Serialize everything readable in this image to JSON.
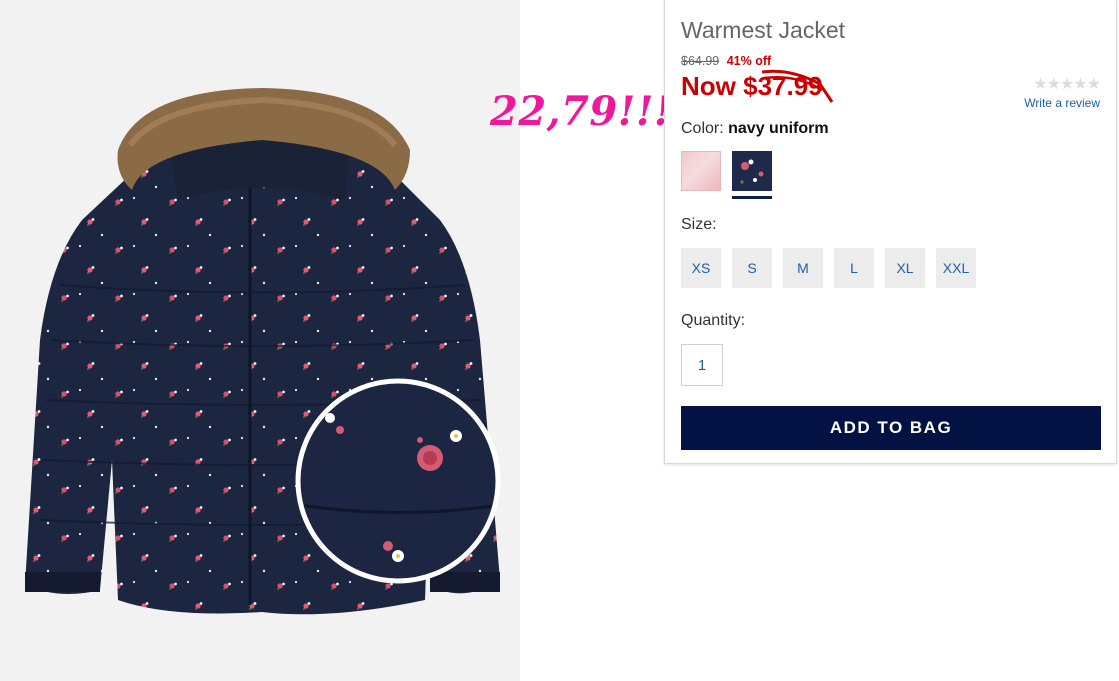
{
  "product": {
    "title": "Warmest Jacket",
    "original_price": "$64.99",
    "discount": "41% off",
    "now_label": "Now ",
    "now_price": "$37.99",
    "annotation": "22,79!!!"
  },
  "rating": {
    "stars": "★★★★★",
    "review_link": "Write a review"
  },
  "color": {
    "label": "Color: ",
    "selected": "navy uniform",
    "swatches": [
      "pink",
      "navy uniform"
    ]
  },
  "size": {
    "label": "Size:",
    "options": [
      "XS",
      "S",
      "M",
      "L",
      "XL",
      "XXL"
    ]
  },
  "quantity": {
    "label": "Quantity:",
    "value": "1"
  },
  "cta": {
    "add_to_bag": "ADD TO BAG"
  },
  "colors": {
    "sale_red": "#cc0000",
    "link_blue": "#1f5fa6",
    "button_navy": "#041243",
    "annotation_pink": "#f0179a"
  }
}
